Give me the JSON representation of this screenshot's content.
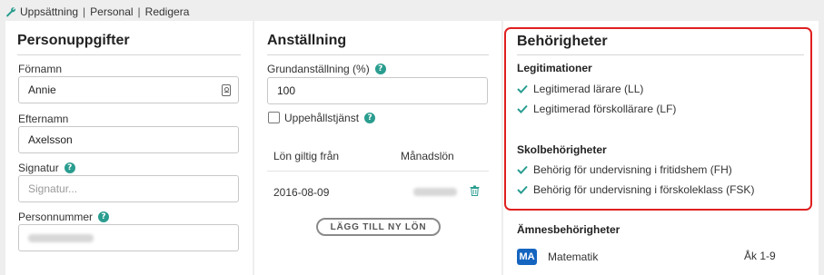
{
  "breadcrumb": {
    "icon": "wrench-icon",
    "items": [
      "Uppsättning",
      "Personal",
      "Redigera"
    ],
    "separator": "|"
  },
  "personal": {
    "title": "Personuppgifter",
    "first_name_label": "Förnamn",
    "first_name_value": "Annie",
    "last_name_label": "Efternamn",
    "last_name_value": "Axelsson",
    "signature_label": "Signatur",
    "signature_placeholder": "Signatur...",
    "ssn_label": "Personnummer"
  },
  "employment": {
    "title": "Anställning",
    "base_label": "Grundanställning (%)",
    "base_value": "100",
    "suspension_label": "Uppehållstjänst",
    "suspension_checked": false,
    "salary_table": {
      "headers": [
        "Lön giltig från",
        "Månadslön"
      ],
      "rows": [
        {
          "valid_from": "2016-08-09"
        }
      ]
    },
    "add_salary_button": "LÄGG TILL NY LÖN"
  },
  "qualifications": {
    "title": "Behörigheter",
    "licenses_title": "Legitimationer",
    "licenses": [
      "Legitimerad lärare (LL)",
      "Legitimerad förskollärare (LF)"
    ],
    "school_title": "Skolbehörigheter",
    "school": [
      "Behörig för undervisning i fritidshem (FH)",
      "Behörig för undervisning i förskoleklass (FSK)"
    ],
    "subjects_title": "Ämnesbehörigheter",
    "subjects": [
      {
        "code": "MA",
        "name": "Matematik",
        "grades": "Åk 1-9"
      }
    ]
  },
  "colors": {
    "accent": "#2a9d8f",
    "highlight": "#e02020",
    "badge": "#1565c0"
  }
}
